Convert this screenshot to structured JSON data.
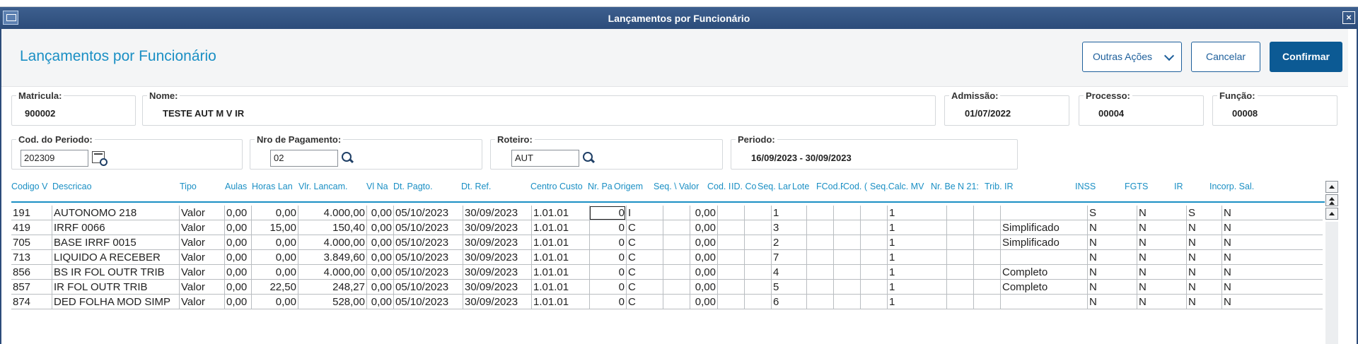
{
  "window": {
    "title": "Lançamentos por Funcionário"
  },
  "header": {
    "title": "Lançamentos por Funcionário",
    "buttons": {
      "outras_acoes": "Outras Ações",
      "cancelar": "Cancelar",
      "confirmar": "Confirmar"
    }
  },
  "fields": {
    "matricula": {
      "label": "Matricula:",
      "value": "900002"
    },
    "nome": {
      "label": "Nome:",
      "value": "TESTE AUT M V IR"
    },
    "admissao": {
      "label": "Admissão:",
      "value": "01/07/2022"
    },
    "processo": {
      "label": "Processo:",
      "value": "00004"
    },
    "funcao": {
      "label": "Função:",
      "value": "00008"
    },
    "cod_periodo": {
      "label": "Cod. do Periodo:",
      "value": "202309"
    },
    "nro_pagamento": {
      "label": "Nro de Pagamento:",
      "value": "02"
    },
    "roteiro": {
      "label": "Roteiro:",
      "value": "AUT"
    },
    "periodo": {
      "label": "Periodo:",
      "value": "16/09/2023 - 30/09/2023"
    }
  },
  "grid": {
    "columns": [
      "Codigo Verba",
      "Descricao",
      "Tipo",
      "Aulas",
      "Horas Lancam.",
      "Vlr. Lancam.",
      "Vl Nao Base",
      "Dt. Pagto.",
      "Dt. Ref.",
      "Centro Custo",
      "Nr. Pagto",
      "Origem",
      "Seq. Valor",
      "Valor Cod.",
      "Cod. ID",
      "ID. Co",
      "Seq. Lan.",
      "Lote",
      "Fcod.R",
      "Cod. (",
      "Seq.Calc. MV",
      "Nr. Bem",
      "N 21:",
      "Trib. IR",
      "INSS",
      "FGTS",
      "IR",
      "Incorp. Sal."
    ],
    "column_headers_display": [
      "Codigo V",
      "Descricao",
      "Tipo",
      "Aulas",
      "Horas Lan",
      "Vlr. Lancam.",
      "Vl Na",
      "Dt. Pagto.",
      "Dt. Ref.",
      "Centro Custo",
      "Nr. Pa",
      "Origem",
      "Seq. \\",
      "Valor",
      "Cod. I",
      "ID. Co",
      "Seq. Lar",
      "Lote",
      "FCod.R",
      "Cod. (",
      "Seq.Calc. MV",
      "Nr. Be",
      "N 21:",
      "Trib. IR",
      "INSS",
      "FGTS",
      "IR",
      "Incorp. Sal."
    ],
    "rows": [
      [
        "191",
        "AUTONOMO 218",
        "Valor",
        "0,00",
        "0,00",
        "4.000,00",
        "0,00",
        "05/10/2023",
        "30/09/2023",
        "1.01.01",
        "0",
        "I",
        "",
        "0,00",
        "",
        "",
        "1",
        "",
        "",
        "",
        "1",
        "",
        "",
        "",
        "S",
        "N",
        "S",
        "N"
      ],
      [
        "419",
        "IRRF 0066",
        "Valor",
        "0,00",
        "15,00",
        "150,40",
        "0,00",
        "05/10/2023",
        "30/09/2023",
        "1.01.01",
        "0",
        "C",
        "",
        "0,00",
        "",
        "",
        "3",
        "",
        "",
        "",
        "1",
        "",
        "",
        "Simplificado",
        "N",
        "N",
        "N",
        "N"
      ],
      [
        "705",
        "BASE IRRF 0015",
        "Valor",
        "0,00",
        "0,00",
        "4.000,00",
        "0,00",
        "05/10/2023",
        "30/09/2023",
        "1.01.01",
        "0",
        "C",
        "",
        "0,00",
        "",
        "",
        "2",
        "",
        "",
        "",
        "1",
        "",
        "",
        "Simplificado",
        "N",
        "N",
        "N",
        "N"
      ],
      [
        "713",
        "LIQUIDO A RECEBER",
        "Valor",
        "0,00",
        "0,00",
        "3.849,60",
        "0,00",
        "05/10/2023",
        "30/09/2023",
        "1.01.01",
        "0",
        "C",
        "",
        "0,00",
        "",
        "",
        "7",
        "",
        "",
        "",
        "1",
        "",
        "",
        "",
        "N",
        "N",
        "N",
        "N"
      ],
      [
        "856",
        "BS IR FOL OUTR TRIB",
        "Valor",
        "0,00",
        "0,00",
        "4.000,00",
        "0,00",
        "05/10/2023",
        "30/09/2023",
        "1.01.01",
        "0",
        "C",
        "",
        "0,00",
        "",
        "",
        "4",
        "",
        "",
        "",
        "1",
        "",
        "",
        "Completo",
        "N",
        "N",
        "N",
        "N"
      ],
      [
        "857",
        "IR FOL OUTR TRIB",
        "Valor",
        "0,00",
        "22,50",
        "248,27",
        "0,00",
        "05/10/2023",
        "30/09/2023",
        "1.01.01",
        "0",
        "C",
        "",
        "0,00",
        "",
        "",
        "5",
        "",
        "",
        "",
        "1",
        "",
        "",
        "Completo",
        "N",
        "N",
        "N",
        "N"
      ],
      [
        "874",
        "DED FOLHA MOD SIMP",
        "Valor",
        "0,00",
        "0,00",
        "528,00",
        "0,00",
        "05/10/2023",
        "30/09/2023",
        "1.01.01",
        "0",
        "C",
        "",
        "0,00",
        "",
        "",
        "6",
        "",
        "",
        "",
        "1",
        "",
        "",
        "",
        "N",
        "N",
        "N",
        "N"
      ]
    ]
  },
  "colors": {
    "titlebar": "#2c4c7a",
    "accent": "#1a8fc4",
    "primary_button": "#0c5a94"
  },
  "icons": [
    "app-window-icon",
    "close-icon",
    "chevron-down-icon",
    "calendar-lookup-icon",
    "search-icon",
    "scroll-top-icon",
    "scroll-page-up-icon",
    "scroll-up-icon"
  ]
}
